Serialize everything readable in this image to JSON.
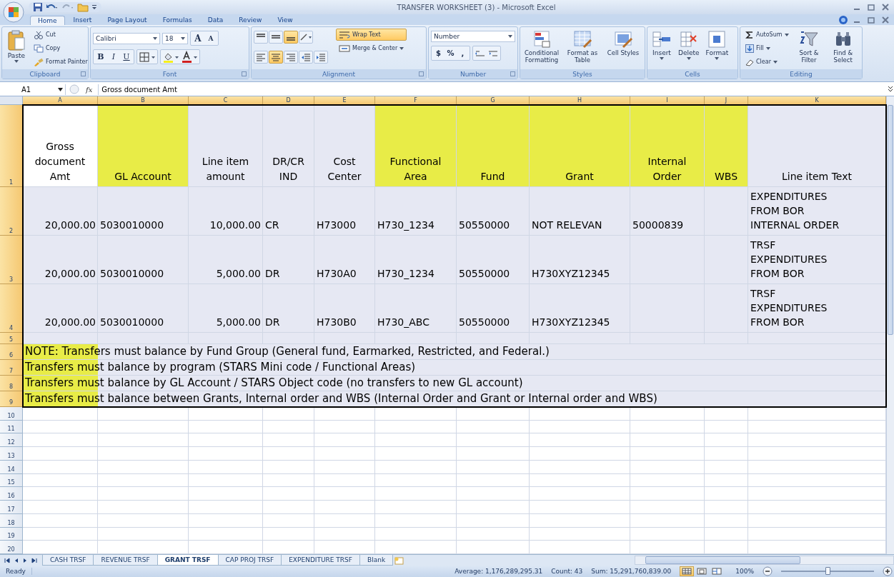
{
  "window": {
    "title": "TRANSFER WORKSHEET (3) - Microsoft Excel"
  },
  "ribbon_tabs": [
    {
      "label": "Home",
      "selected": true
    },
    {
      "label": "Insert",
      "selected": false
    },
    {
      "label": "Page Layout",
      "selected": false
    },
    {
      "label": "Formulas",
      "selected": false
    },
    {
      "label": "Data",
      "selected": false
    },
    {
      "label": "Review",
      "selected": false
    },
    {
      "label": "View",
      "selected": false
    }
  ],
  "ribbon": {
    "clipboard": {
      "title": "Clipboard",
      "paste": "Paste",
      "items": [
        {
          "label": "Cut",
          "kind": "cut"
        },
        {
          "label": "Copy",
          "kind": "copy"
        },
        {
          "label": "Format Painter",
          "kind": "painter"
        }
      ]
    },
    "font": {
      "title": "Font",
      "family": "Calibri",
      "size": "18",
      "size_buttons": [
        "A",
        "A"
      ],
      "style_buttons": [
        {
          "label": "B",
          "kind": "bold"
        },
        {
          "label": "I",
          "kind": "italic"
        },
        {
          "label": "U",
          "kind": "underline"
        }
      ]
    },
    "alignment": {
      "title": "Alignment",
      "buttons": [
        {
          "kind": "top",
          "on": false
        },
        {
          "kind": "middle",
          "on": false
        },
        {
          "kind": "bottom",
          "on": true
        },
        {
          "kind": "orientation",
          "on": false
        },
        {
          "kind": "left",
          "on": false
        },
        {
          "kind": "center",
          "on": true
        },
        {
          "kind": "right",
          "on": false
        },
        {
          "kind": "outdent",
          "on": false
        },
        {
          "kind": "indent",
          "on": false
        }
      ],
      "wrap": {
        "label": "Wrap Text",
        "on": true
      },
      "merge": "Merge & Center"
    },
    "number": {
      "title": "Number",
      "format": "Number",
      "buttons": [
        "$",
        "%",
        ","
      ]
    },
    "styles": {
      "title": "Styles",
      "buttons": [
        {
          "label": "Conditional Formatting",
          "kind": "conditional"
        },
        {
          "label": "Format as Table",
          "kind": "table"
        },
        {
          "label": "Cell Styles",
          "kind": "cellstyles"
        }
      ]
    },
    "cells": {
      "title": "Cells",
      "buttons": [
        {
          "label": "Insert",
          "kind": "insert"
        },
        {
          "label": "Delete",
          "kind": "delete"
        },
        {
          "label": "Format",
          "kind": "format"
        }
      ]
    },
    "editing": {
      "title": "Editing",
      "small": [
        {
          "label": "AutoSum",
          "kind": "sum"
        },
        {
          "label": "Fill",
          "kind": "fill"
        },
        {
          "label": "Clear",
          "kind": "clear"
        }
      ],
      "large": [
        {
          "label": "Sort & Filter",
          "kind": "sort"
        },
        {
          "label": "Find & Select",
          "kind": "find"
        }
      ]
    }
  },
  "formula_bar": {
    "cell": "A1",
    "fx": "fx",
    "content": "Gross document Amt"
  },
  "columns": [
    {
      "letter": "A",
      "selected": true,
      "numeric": true
    },
    {
      "letter": "B",
      "selected": true,
      "numeric": false
    },
    {
      "letter": "C",
      "selected": true,
      "numeric": true
    },
    {
      "letter": "D",
      "selected": true,
      "numeric": false
    },
    {
      "letter": "E",
      "selected": true,
      "numeric": false
    },
    {
      "letter": "F",
      "selected": true,
      "numeric": false
    },
    {
      "letter": "G",
      "selected": true,
      "numeric": false
    },
    {
      "letter": "H",
      "selected": true,
      "numeric": false
    },
    {
      "letter": "I",
      "selected": true,
      "numeric": false
    },
    {
      "letter": "J",
      "selected": true,
      "numeric": false
    },
    {
      "letter": "K",
      "selected": true,
      "numeric": false
    }
  ],
  "rows": [
    {
      "label": "1",
      "selected": true
    },
    {
      "label": "2",
      "selected": true
    },
    {
      "label": "3",
      "selected": true
    },
    {
      "label": "4",
      "selected": true
    },
    {
      "label": "5",
      "selected": true
    },
    {
      "label": "6",
      "selected": true
    },
    {
      "label": "7",
      "selected": true
    },
    {
      "label": "8",
      "selected": true
    },
    {
      "label": "9",
      "selected": true
    },
    {
      "label": "10",
      "selected": false
    },
    {
      "label": "11",
      "selected": false
    },
    {
      "label": "12",
      "selected": false
    },
    {
      "label": "13",
      "selected": false
    },
    {
      "label": "14",
      "selected": false
    },
    {
      "label": "15",
      "selected": false
    },
    {
      "label": "16",
      "selected": false
    },
    {
      "label": "17",
      "selected": false
    },
    {
      "label": "18",
      "selected": false
    },
    {
      "label": "19",
      "selected": false
    },
    {
      "label": "20",
      "selected": false
    }
  ],
  "header_row": [
    {
      "text": "Gross document Amt",
      "highlighted": false,
      "active": true
    },
    {
      "text": "GL Account",
      "highlighted": true,
      "active": false
    },
    {
      "text": "Line item amount",
      "highlighted": false,
      "active": false
    },
    {
      "text": "DR/CR IND",
      "highlighted": false,
      "active": false
    },
    {
      "text": "Cost Center",
      "highlighted": false,
      "active": false
    },
    {
      "text": "Functional Area",
      "highlighted": true,
      "active": false
    },
    {
      "text": "Fund",
      "highlighted": true,
      "active": false
    },
    {
      "text": "Grant",
      "highlighted": true,
      "active": false
    },
    {
      "text": "Internal Order",
      "highlighted": true,
      "active": false
    },
    {
      "text": "WBS",
      "highlighted": true,
      "active": false
    },
    {
      "text": "Line item Text",
      "highlighted": false,
      "active": false
    }
  ],
  "data_rows": [
    {
      "A": "20,000.00",
      "B": "5030010000",
      "C": "10,000.00",
      "D": "CR",
      "E": "H73000",
      "F": "H730_1234",
      "G": "50550000",
      "H": "NOT RELEVAN",
      "I": "50000839",
      "K": "EXPENDITURES FROM BOR INTERNAL ORDER"
    },
    {
      "A": "20,000.00",
      "B": "5030010000",
      "C": "5,000.00",
      "D": "DR",
      "E": "H730A0",
      "F": "H730_1234",
      "G": "50550000",
      "H": "H730XYZ12345",
      "K": "TRSF EXPENDITURES FROM BOR"
    },
    {
      "A": "20,000.00",
      "B": "5030010000",
      "C": "5,000.00",
      "D": "DR",
      "E": "H730B0",
      "F": "H730_ABC",
      "G": "50550000",
      "H": "H730XYZ12345",
      "K": "TRSF EXPENDITURES FROM BOR"
    }
  ],
  "notes": [
    {
      "text": "NOTE:  Transfers must balance by Fund Group (General fund, Earmarked, Restricted, and Federal.)",
      "highlighted": true
    },
    {
      "text": "Transfers must balance by program (STARS Mini code / Functional Areas)",
      "highlighted": true
    },
    {
      "text": "Transfers must balance by GL Account / STARS Object code (no transfers to new GL account)",
      "highlighted": true
    },
    {
      "text": "Transfers must balance between Grants, Internal order and WBS (Internal Order and Grant or Internal order and WBS)",
      "highlighted": true
    }
  ],
  "sheet_tabs": [
    {
      "label": "CASH TRSF",
      "selected": false
    },
    {
      "label": "REVENUE TRSF",
      "selected": false
    },
    {
      "label": "GRANT TRSF",
      "selected": true
    },
    {
      "label": "CAP PROJ TRSF",
      "selected": false
    },
    {
      "label": "EXPENDITURE TRSF",
      "selected": false
    },
    {
      "label": "Blank",
      "selected": false
    }
  ],
  "status_bar": {
    "mode": "Ready",
    "average": "Average: 1,176,289,295.31",
    "count": "Count: 43",
    "sum": "Sum: 15,291,760,839.00",
    "views": [
      {
        "kind": "normal",
        "selected": true
      },
      {
        "kind": "layout",
        "selected": false
      },
      {
        "kind": "break",
        "selected": false
      }
    ],
    "zoom": "100%",
    "zoom_slider": {
      "level": 0.5
    }
  }
}
